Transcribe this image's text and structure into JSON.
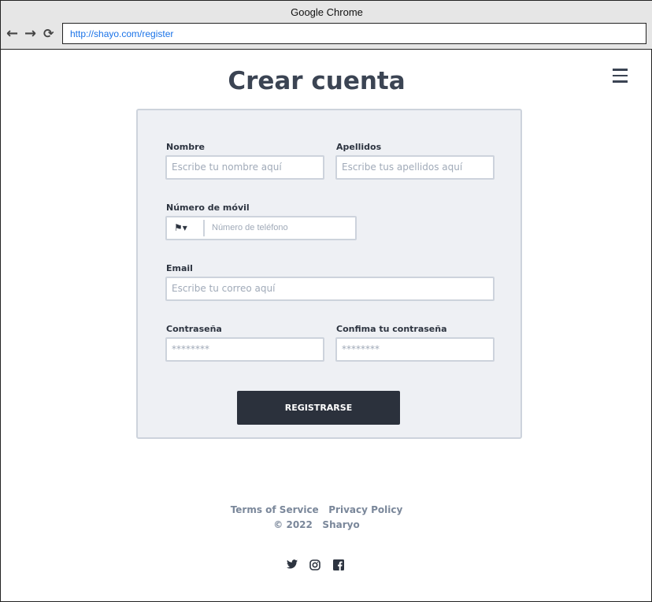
{
  "browser": {
    "title": "Google Chrome",
    "url": "http://shayo.com/register"
  },
  "page": {
    "title": "Crear cuenta"
  },
  "form": {
    "first_name": {
      "label": "Nombre",
      "placeholder": "Escribe tu nombre aquí"
    },
    "last_name": {
      "label": "Apellidos",
      "placeholder": "Escribe tus apellidos aquí"
    },
    "phone": {
      "label": "Número de móvil",
      "placeholder": "Número de teléfono"
    },
    "email": {
      "label": "Email",
      "placeholder": "Escribe tu correo aquí"
    },
    "password": {
      "label": "Contraseña",
      "placeholder": "********"
    },
    "confirm": {
      "label": "Confima tu contraseña",
      "placeholder": "********"
    },
    "submit": "REGISTRARSE"
  },
  "footer": {
    "terms": "Terms of Service",
    "privacy": "Privacy Policy",
    "copyright": "© 2022",
    "brand": "Sharyo"
  }
}
